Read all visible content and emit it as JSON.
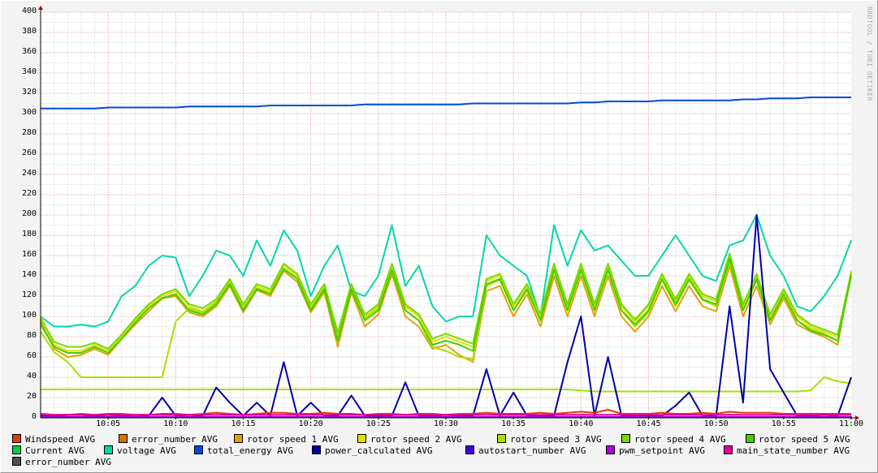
{
  "chart_data": {
    "type": "line",
    "title": "",
    "xlabel": "",
    "ylabel": "",
    "ylim": [
      0,
      400
    ],
    "y_ticks": [
      "0",
      "20",
      "40",
      "60",
      "80",
      "100",
      "120",
      "140",
      "160",
      "180",
      "200",
      "220",
      "240",
      "260",
      "280",
      "300",
      "320",
      "340",
      "360",
      "380",
      "400"
    ],
    "x_range_minutes": [
      0,
      60
    ],
    "x_ticks": [
      {
        "min": 5,
        "label": "10:05"
      },
      {
        "min": 10,
        "label": "10:10"
      },
      {
        "min": 15,
        "label": "10:15"
      },
      {
        "min": 20,
        "label": "10:20"
      },
      {
        "min": 25,
        "label": "10:25"
      },
      {
        "min": 30,
        "label": "10:30"
      },
      {
        "min": 35,
        "label": "10:35"
      },
      {
        "min": 40,
        "label": "10:40"
      },
      {
        "min": 45,
        "label": "10:45"
      },
      {
        "min": 50,
        "label": "10:50"
      },
      {
        "min": 55,
        "label": "10:55"
      },
      {
        "min": 60,
        "label": "11:00"
      }
    ],
    "grid": true,
    "legend_position": "bottom",
    "legend": [
      {
        "label": "Windspeed AVG",
        "color": "#e03c00"
      },
      {
        "label": "error_number AVG",
        "color": "#d87000"
      },
      {
        "label": "rotor speed 1 AVG",
        "color": "#e0a400"
      },
      {
        "label": "rotor speed 2 AVG",
        "color": "#e0e000"
      },
      {
        "label": "rotor speed 3 AVG",
        "color": "#a8e000"
      },
      {
        "label": "rotor speed 4 AVG",
        "color": "#78d800"
      },
      {
        "label": "rotor speed 5 AVG",
        "color": "#40d000"
      },
      {
        "label": "Current AVG",
        "color": "#00d040"
      },
      {
        "label": "voltage AVG",
        "color": "#00d8a8"
      },
      {
        "label": "total_energy AVG",
        "color": "#0048e0"
      },
      {
        "label": "power_calculated AVG",
        "color": "#0000a8"
      },
      {
        "label": "autostart_number AVG",
        "color": "#4000e0"
      },
      {
        "label": "pwm_setpoint AVG",
        "color": "#b000e0"
      },
      {
        "label": "main_state_number AVG",
        "color": "#e000a0"
      },
      {
        "label": "error_number AVG",
        "color": "#505050"
      }
    ],
    "series": [
      {
        "name": "voltage AVG",
        "color": "#00d8a8",
        "values": [
          100,
          90,
          90,
          92,
          90,
          95,
          120,
          130,
          150,
          160,
          158,
          120,
          140,
          165,
          160,
          140,
          175,
          150,
          185,
          165,
          120,
          150,
          170,
          125,
          120,
          140,
          190,
          130,
          150,
          110,
          95,
          100,
          100,
          180,
          160,
          150,
          140,
          100,
          190,
          150,
          185,
          165,
          170,
          155,
          140,
          140,
          160,
          180,
          160,
          140,
          135,
          170,
          175,
          200,
          160,
          140,
          110,
          105,
          120,
          140,
          175
        ]
      },
      {
        "name": "rotor speed 1 AVG",
        "color": "#e0a400",
        "values": [
          95,
          68,
          60,
          62,
          68,
          62,
          78,
          92,
          105,
          118,
          120,
          104,
          100,
          110,
          130,
          104,
          126,
          120,
          145,
          134,
          104,
          124,
          70,
          124,
          90,
          102,
          142,
          100,
          90,
          68,
          72,
          62,
          55,
          125,
          130,
          100,
          122,
          90,
          140,
          100,
          140,
          100,
          140,
          100,
          85,
          100,
          130,
          105,
          130,
          110,
          105,
          150,
          100,
          130,
          92,
          118,
          92,
          85,
          80,
          72,
          145
        ]
      },
      {
        "name": "rotor speed 2 AVG",
        "color": "#e0e000",
        "values": [
          100,
          72,
          66,
          66,
          72,
          66,
          80,
          96,
          110,
          120,
          125,
          110,
          105,
          115,
          135,
          110,
          130,
          125,
          150,
          140,
          110,
          130,
          80,
          130,
          100,
          110,
          150,
          110,
          100,
          75,
          80,
          75,
          70,
          135,
          140,
          110,
          130,
          100,
          150,
          110,
          150,
          110,
          150,
          110,
          95,
          110,
          140,
          115,
          140,
          120,
          115,
          160,
          110,
          140,
          100,
          125,
          100,
          90,
          85,
          80,
          145
        ]
      },
      {
        "name": "rotor speed 3 AVG",
        "color": "#a8e000",
        "values": [
          85,
          65,
          55,
          40,
          40,
          40,
          40,
          40,
          40,
          40,
          95,
          108,
          104,
          114,
          133,
          108,
          128,
          123,
          147,
          138,
          108,
          128,
          78,
          128,
          98,
          108,
          146,
          106,
          96,
          70,
          66,
          60,
          58,
          130,
          136,
          106,
          126,
          96,
          146,
          106,
          146,
          106,
          146,
          106,
          90,
          104,
          136,
          110,
          136,
          116,
          110,
          155,
          106,
          136,
          96,
          121,
          96,
          88,
          83,
          76,
          142
        ]
      },
      {
        "name": "rotor speed 3 AVG (flat)",
        "color": "#a8e000",
        "values": [
          28,
          28,
          28,
          28,
          28,
          28,
          28,
          28,
          28,
          28,
          28,
          28,
          28,
          28,
          28,
          28,
          28,
          28,
          28,
          28,
          28,
          28,
          28,
          28,
          28,
          28,
          28,
          28,
          28,
          28,
          28,
          28,
          28,
          28,
          28,
          28,
          28,
          28,
          28,
          28,
          27,
          26,
          26,
          26,
          26,
          26,
          26,
          26,
          26,
          26,
          26,
          26,
          26,
          26,
          26,
          26,
          26,
          27,
          40,
          36,
          34
        ]
      },
      {
        "name": "rotor speed 4 AVG",
        "color": "#78d800",
        "values": [
          98,
          75,
          70,
          70,
          74,
          68,
          82,
          98,
          112,
          122,
          127,
          112,
          108,
          117,
          137,
          112,
          132,
          127,
          152,
          142,
          112,
          132,
          84,
          132,
          102,
          112,
          152,
          112,
          102,
          78,
          83,
          78,
          73,
          137,
          142,
          112,
          132,
          102,
          152,
          112,
          152,
          112,
          152,
          112,
          97,
          112,
          142,
          117,
          142,
          122,
          117,
          162,
          112,
          142,
          102,
          127,
          102,
          92,
          87,
          82,
          143
        ]
      },
      {
        "name": "rotor speed 5 AVG",
        "color": "#40d000",
        "values": [
          92,
          70,
          64,
          64,
          70,
          64,
          78,
          94,
          108,
          118,
          122,
          106,
          102,
          112,
          132,
          106,
          127,
          122,
          147,
          137,
          106,
          127,
          76,
          127,
          96,
          106,
          146,
          106,
          96,
          72,
          76,
          72,
          66,
          132,
          137,
          106,
          127,
          96,
          146,
          106,
          146,
          106,
          146,
          106,
          92,
          106,
          137,
          112,
          137,
          117,
          112,
          157,
          106,
          137,
          96,
          122,
          96,
          86,
          82,
          76,
          140
        ]
      },
      {
        "name": "total_energy AVG",
        "color": "#0048e0",
        "values": [
          305,
          305,
          305,
          305,
          305,
          306,
          306,
          306,
          306,
          306,
          306,
          307,
          307,
          307,
          307,
          307,
          307,
          308,
          308,
          308,
          308,
          308,
          308,
          308,
          309,
          309,
          309,
          309,
          309,
          309,
          309,
          309,
          310,
          310,
          310,
          310,
          310,
          310,
          310,
          310,
          311,
          311,
          312,
          312,
          312,
          312,
          313,
          313,
          313,
          313,
          313,
          313,
          314,
          314,
          315,
          315,
          315,
          316,
          316,
          316,
          316
        ]
      },
      {
        "name": "power_calculated AVG",
        "color": "#0000a8",
        "values": [
          2,
          2,
          1,
          1,
          2,
          1,
          2,
          1,
          2,
          20,
          2,
          1,
          2,
          30,
          15,
          2,
          15,
          2,
          55,
          2,
          15,
          2,
          2,
          22,
          2,
          2,
          2,
          35,
          2,
          2,
          1,
          2,
          2,
          48,
          2,
          25,
          2,
          2,
          2,
          55,
          100,
          2,
          60,
          2,
          2,
          2,
          2,
          12,
          25,
          2,
          2,
          110,
          15,
          200,
          48,
          25,
          2,
          2,
          1,
          2,
          40
        ]
      },
      {
        "name": "Windspeed AVG",
        "color": "#e03c00",
        "values": [
          4,
          3,
          3,
          4,
          3,
          4,
          4,
          3,
          3,
          4,
          4,
          3,
          4,
          5,
          4,
          3,
          4,
          5,
          5,
          4,
          4,
          5,
          4,
          4,
          3,
          4,
          4,
          3,
          4,
          4,
          3,
          4,
          4,
          5,
          4,
          4,
          4,
          5,
          4,
          5,
          6,
          5,
          8,
          4,
          4,
          4,
          5,
          4,
          4,
          5,
          4,
          6,
          5,
          5,
          5,
          4,
          4,
          4,
          4,
          4,
          4
        ]
      },
      {
        "name": "main_state_number AVG",
        "color": "#e000a0",
        "values": [
          3,
          3,
          3,
          3,
          3,
          3,
          3,
          3,
          3,
          3,
          3,
          3,
          3,
          3,
          3,
          3,
          3,
          3,
          3,
          3,
          3,
          3,
          3,
          3,
          3,
          3,
          3,
          3,
          3,
          3,
          3,
          3,
          3,
          3,
          3,
          3,
          3,
          3,
          3,
          3,
          3,
          3,
          3,
          3,
          3,
          3,
          3,
          3,
          3,
          3,
          3,
          3,
          3,
          3,
          3,
          3,
          3,
          3,
          3,
          3,
          3
        ]
      },
      {
        "name": "pwm_setpoint AVG",
        "color": "#b000e0",
        "values": [
          1,
          1,
          1,
          1,
          1,
          1,
          1,
          1,
          1,
          1,
          1,
          1,
          1,
          1,
          1,
          1,
          1,
          1,
          1,
          1,
          1,
          1,
          1,
          1,
          1,
          1,
          1,
          1,
          1,
          1,
          1,
          1,
          1,
          1,
          1,
          1,
          1,
          1,
          1,
          1,
          1,
          1,
          1,
          1,
          1,
          1,
          1,
          1,
          1,
          1,
          1,
          1,
          1,
          1,
          1,
          1,
          1,
          1,
          1,
          1,
          1
        ]
      }
    ]
  },
  "side_text": "RRDTOOL / TOBI OETIKER"
}
